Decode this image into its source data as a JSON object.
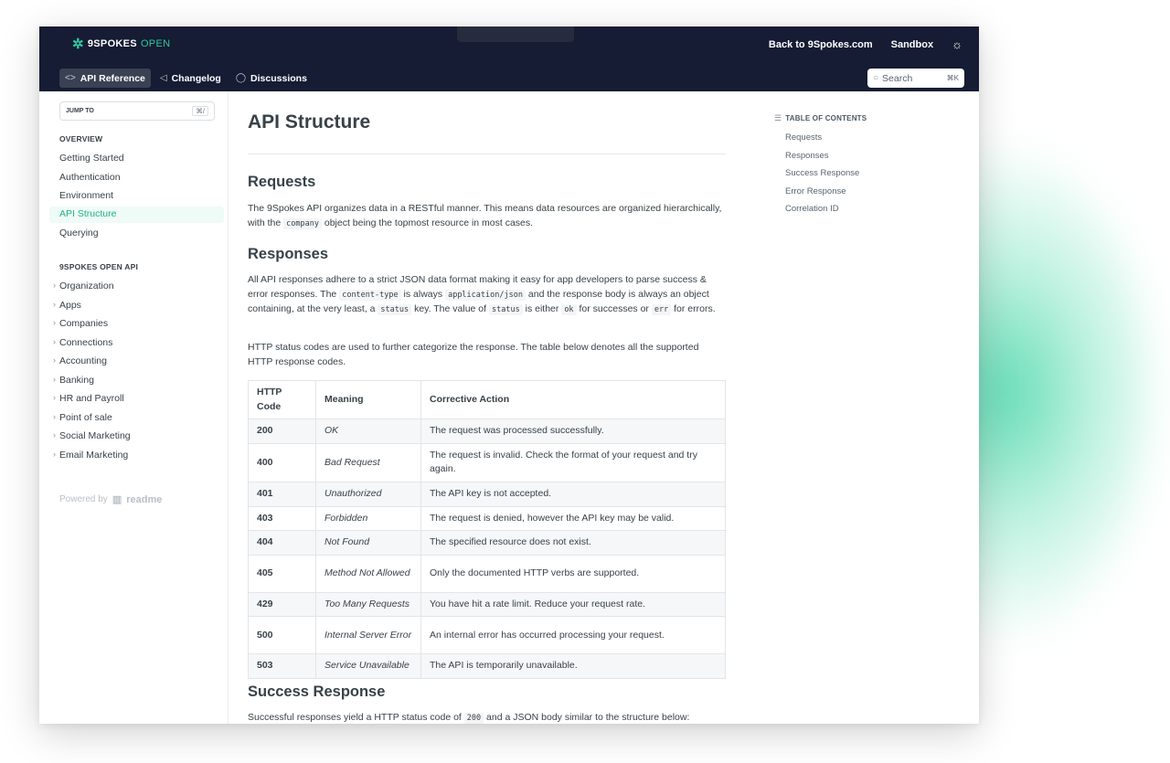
{
  "header": {
    "brand": "9SPOKES",
    "brand_suffix": "OPEN",
    "back_link": "Back to 9Spokes.com",
    "sandbox_link": "Sandbox",
    "nav_tabs": [
      {
        "label": "API Reference",
        "icon": "code-icon"
      },
      {
        "label": "Changelog",
        "icon": "megaphone-icon"
      },
      {
        "label": "Discussions",
        "icon": "chat-icon"
      }
    ],
    "search": {
      "placeholder": "Search",
      "shortcut": "⌘K"
    }
  },
  "sidebar": {
    "jump_to": "JUMP TO",
    "jump_shortcut": "⌘/",
    "overview_title": "OVERVIEW",
    "overview_items": [
      "Getting Started",
      "Authentication",
      "Environment",
      "API Structure",
      "Querying"
    ],
    "api_title": "9SPOKES OPEN API",
    "api_items": [
      "Organization",
      "Apps",
      "Companies",
      "Connections",
      "Accounting",
      "Banking",
      "HR and Payroll",
      "Point of sale",
      "Social Marketing",
      "Email Marketing"
    ],
    "powered_by": "Powered by",
    "powered_brand": "readme"
  },
  "main": {
    "title": "API Structure",
    "requests_heading": "Requests",
    "requests_p1": "The 9Spokes API organizes data in a RESTful manner. This means data resources are organized hierarchically, with the",
    "requests_code": "company",
    "requests_p2": "object being the topmost resource in most cases.",
    "responses_heading": "Responses",
    "resp_t1": "All API responses adhere to a strict JSON data format making it easy for app developers to parse success & error responses. The",
    "resp_c1": "content-type",
    "resp_t2": "is always",
    "resp_c2": "application/json",
    "resp_t3": "and the response body is always an object containing, at the very least, a",
    "resp_c3": "status",
    "resp_t4": "key. The value of",
    "resp_c4": "status",
    "resp_t5": "is either",
    "resp_c5": "ok",
    "resp_t6": "for successes or",
    "resp_c6": "err",
    "resp_t7": "for errors.",
    "http_p": "HTTP status codes are used to further categorize the response. The table below denotes all the supported HTTP response codes.",
    "table": {
      "headers": [
        "HTTP Code",
        "Meaning",
        "Corrective Action"
      ],
      "rows": [
        {
          "code": "200",
          "meaning": "OK",
          "action": "The request was processed successfully."
        },
        {
          "code": "400",
          "meaning": "Bad Request",
          "action": "The request is invalid. Check the format of your request and try again."
        },
        {
          "code": "401",
          "meaning": "Unauthorized",
          "action": "The API key is not accepted."
        },
        {
          "code": "403",
          "meaning": "Forbidden",
          "action": "The request is denied, however the API key may be valid."
        },
        {
          "code": "404",
          "meaning": "Not Found",
          "action": "The specified resource does not exist."
        },
        {
          "code": "405",
          "meaning": "Method Not Allowed",
          "action": "Only the documented HTTP verbs are supported."
        },
        {
          "code": "429",
          "meaning": "Too Many Requests",
          "action": "You have hit a rate limit. Reduce your request rate."
        },
        {
          "code": "500",
          "meaning": "Internal Server Error",
          "action": "An internal error has occurred processing your request."
        },
        {
          "code": "503",
          "meaning": "Service Unavailable",
          "action": "The API is temporarily unavailable."
        }
      ]
    },
    "success_heading": "Success Response",
    "success_t1": "Successful responses yield a HTTP status code of",
    "success_code": "200",
    "success_t2": "and a JSON body similar to the structure below:"
  },
  "toc": {
    "title": "TABLE OF CONTENTS",
    "items": [
      "Requests",
      "Responses",
      "Success Response",
      "Error Response",
      "Correlation ID"
    ]
  },
  "colors": {
    "header_bg": "#151c33",
    "accent": "#1fb387",
    "active_bg": "#effbf6"
  }
}
